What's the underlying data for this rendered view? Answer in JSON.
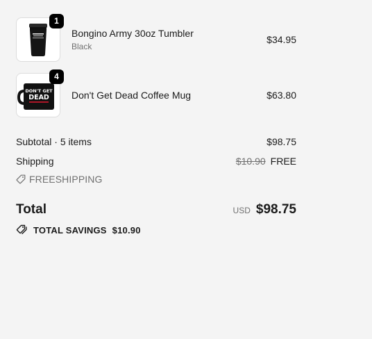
{
  "items": [
    {
      "name": "Bongino Army 30oz Tumbler",
      "variant": "Black",
      "price": "$34.95",
      "quantity": "1",
      "image_icon": "tumbler-image"
    },
    {
      "name": "Don't Get Dead Coffee Mug",
      "variant": "",
      "price": "$63.80",
      "quantity": "4",
      "image_icon": "mug-image",
      "image_text": [
        "DON'T GET",
        "DEAD"
      ]
    }
  ],
  "subtotal": {
    "label": "Subtotal · 5 items",
    "value": "$98.75"
  },
  "shipping": {
    "label": "Shipping",
    "original": "$10.90",
    "value": "FREE"
  },
  "discount_code": "FREESHIPPING",
  "total": {
    "label": "Total",
    "currency": "USD",
    "value": "$98.75"
  },
  "savings": {
    "label": "TOTAL SAVINGS",
    "value": "$10.90"
  },
  "colors": {
    "background": "#f4f4f4",
    "badge": "#000000",
    "muted": "#707070"
  }
}
